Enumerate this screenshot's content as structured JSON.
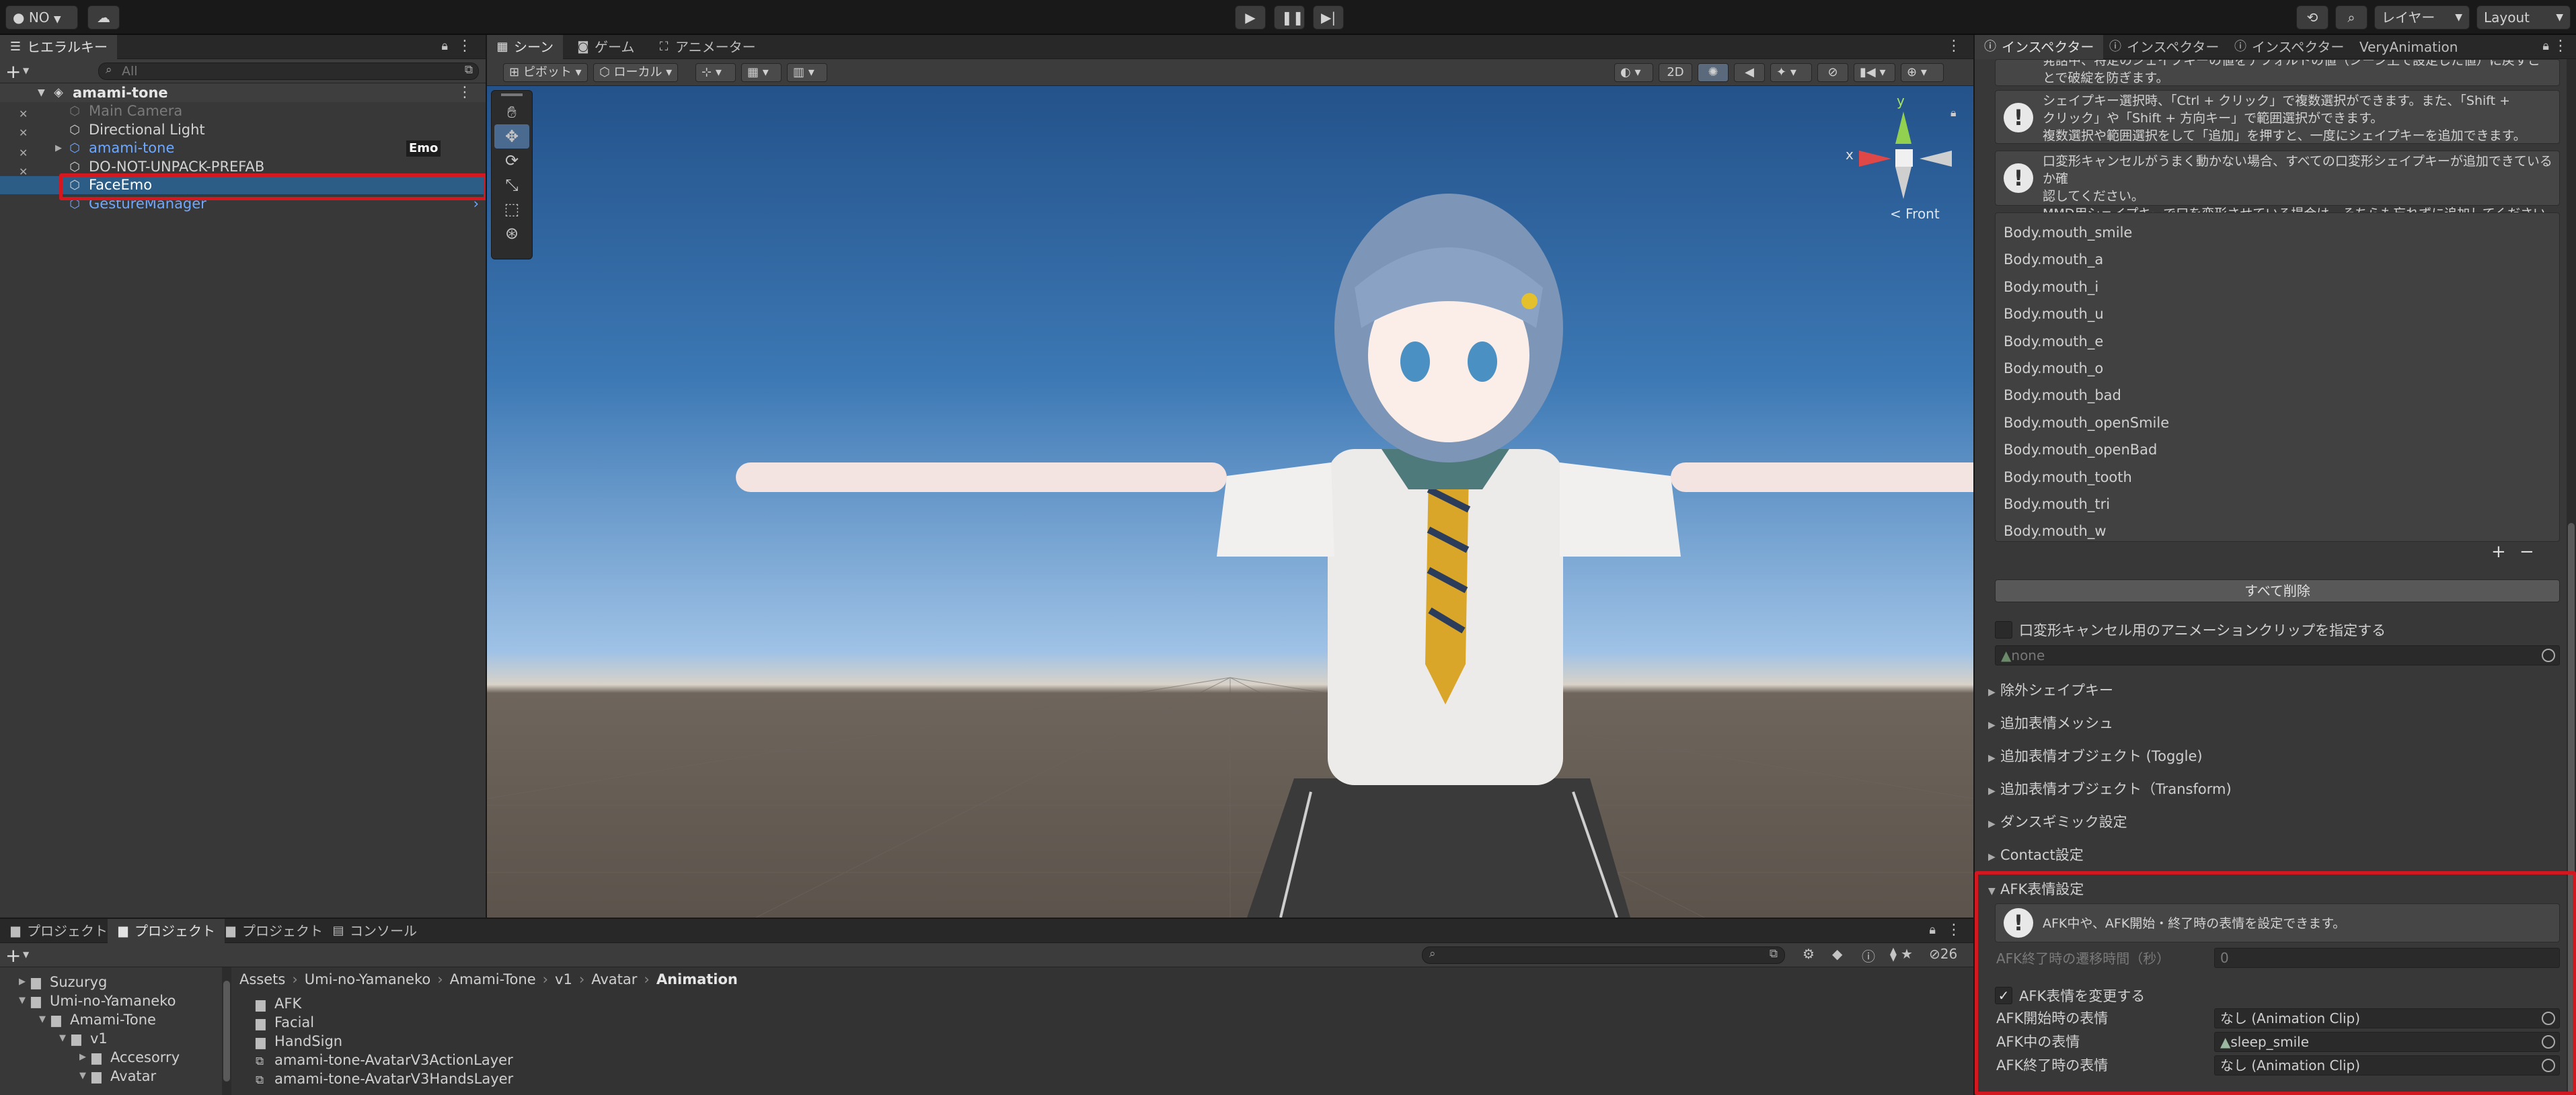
{
  "toolbar": {
    "account": "NO",
    "history_icon": "history-icon",
    "search_icon": "search-icon",
    "layers": "レイヤー",
    "layout": "Layout"
  },
  "hierarchy": {
    "tab": "ヒエラルキー",
    "search_placeholder": "All",
    "scene": "amami-tone",
    "items": [
      {
        "label": "Main Camera",
        "color": "#7a7a7a"
      },
      {
        "label": "Directional Light",
        "color": "#d2d2d2"
      },
      {
        "label": "amami-tone",
        "color": "#6fa8ff",
        "badge": "Emo"
      },
      {
        "label": "DO-NOT-UNPACK-PREFAB",
        "color": "#d2d2d2"
      },
      {
        "label": "FaceEmo",
        "color": "#ffffff"
      },
      {
        "label": "GestureManager",
        "color": "#6fa8ff"
      }
    ]
  },
  "scene_tabs": [
    "シーン",
    "ゲーム",
    "アニメーター"
  ],
  "scene_toolbar": {
    "pivot": "ピボット",
    "local": "ローカル",
    "mode_2d": "2D",
    "gizmo_front": "< Front",
    "axis_y": "y",
    "axis_x": "x"
  },
  "inspector": {
    "tabs": [
      "インスペクター",
      "インスペクター",
      "インスペクター",
      "VeryAnimation"
    ],
    "help_top_partial": "発話中、特定のシェイプキーの値をデフォルトの値（シーン上で設定した値）に戻すことで破綻を防ぎます。",
    "help1": [
      "シェイプキー選択時、「Ctrl + クリック」で複数選択ができます。また、「Shift +",
      "クリック」や「Shift + 方向キー」で範囲選択ができます。",
      "複数選択や範囲選択をして「追加」を押すと、一度にシェイプキーを追加できます。"
    ],
    "help2": [
      "口変形キャンセルがうまく動かない場合、すべての口変形シェイプキーが追加できているか確",
      "認してください。",
      "MMD用シェイプキーで口を変形させている場合は、そちらも忘れずに追加してください"
    ],
    "shapekeys": [
      "Body.mouth_smile",
      "Body.mouth_a",
      "Body.mouth_i",
      "Body.mouth_u",
      "Body.mouth_e",
      "Body.mouth_o",
      "Body.mouth_bad",
      "Body.mouth_openSmile",
      "Body.mouth_openBad",
      "Body.mouth_tooth",
      "Body.mouth_tri",
      "Body.mouth_w"
    ],
    "plus": "+",
    "minus": "−",
    "delete_all": "すべて削除",
    "mouth_cancel_toggle": "口変形キャンセル用のアニメーションクリップを指定する",
    "mouth_cancel_value": "none",
    "folds": [
      "除外シェイプキー",
      "追加表情メッシュ",
      "追加表情オブジェクト (Toggle)",
      "追加表情オブジェクト（Transform)",
      "ダンスギミック設定",
      "Contact設定"
    ],
    "afk_fold": "AFK表情設定",
    "afk_help": "AFK中や、AFK開始・終了時の表情を設定できます。",
    "afk_transition_label": "AFK終了時の遷移時間（秒）",
    "afk_transition_value": "0",
    "afk_change_toggle": "AFK表情を変更する",
    "afk_fields": [
      {
        "label": "AFK開始時の表情",
        "value": "なし (Animation Clip)"
      },
      {
        "label": "AFK中の表情",
        "value": "sleep_smile"
      },
      {
        "label": "AFK終了時の表情",
        "value": "なし (Animation Clip)"
      }
    ]
  },
  "project": {
    "tabs": [
      "プロジェクト",
      "プロジェクト",
      "プロジェクト",
      "コンソール"
    ],
    "hidden_count": "26",
    "tree": [
      "Suzuryg",
      "Umi-no-Yamaneko",
      "Amami-Tone",
      "v1",
      "Accesorry",
      "Avatar"
    ],
    "breadcrumb": [
      "Assets",
      "Umi-no-Yamaneko",
      "Amami-Tone",
      "v1",
      "Avatar",
      "Animation"
    ],
    "files": [
      {
        "label": "AFK",
        "kind": "folder"
      },
      {
        "label": "Facial",
        "kind": "folder"
      },
      {
        "label": "HandSign",
        "kind": "folder"
      },
      {
        "label": "amami-tone-AvatarV3ActionLayer",
        "kind": "controller"
      },
      {
        "label": "amami-tone-AvatarV3HandsLayer",
        "kind": "controller"
      }
    ]
  }
}
